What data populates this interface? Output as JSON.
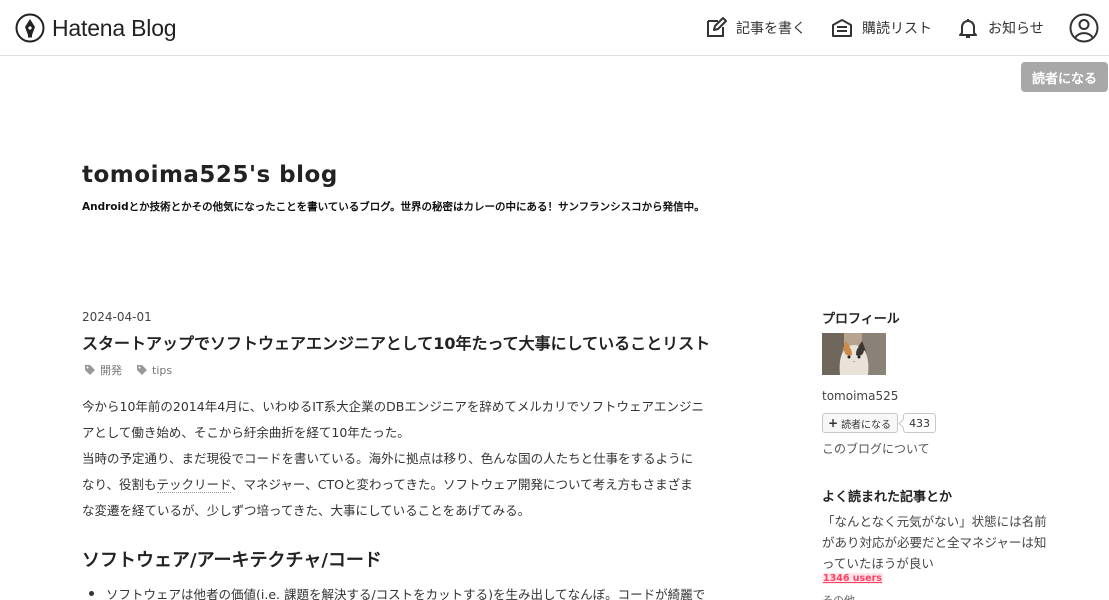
{
  "header": {
    "brand": "Hatena Blog",
    "nav": {
      "write": "記事を書く",
      "subscriptions": "購読リスト",
      "notifications": "お知らせ"
    },
    "subscribe_button": "読者になる"
  },
  "blog": {
    "title": "tomoima525's blog",
    "description": "Androidとか技術とかその他気になったことを書いているブログ。世界の秘密はカレーの中にある！サンフランシスコから発信中。"
  },
  "entry": {
    "date": "2024-04-01",
    "title": "スタートアップでソフトウェアエンジニアとして10年たって大事にしていることリスト",
    "categories": [
      "開発",
      "tips"
    ],
    "body": {
      "line1": "今から10年前の2014年4月に、いわゆるIT系大企業のDBエンジニアを辞めてメルカリでソフトウェアエンジニ",
      "line2": "アとして働き始め、そこから紆余曲折を経て10年たった。",
      "line3": "当時の予定通り、まだ現役でコードを書いている。海外に拠点は移り、色んな国の人たちと仕事をするように",
      "line4_pre": "なり、役割も",
      "line4_link": "テックリード",
      "line4_post": "、マネジャー、CTOと変わってきた。ソフトウェア開発について考え方もさまざま",
      "line5": "な変遷を経ているが、少しずつ培ってきた、大事にしていることをあげてみる。"
    },
    "section_heading": "ソフトウェア/アーキテクチャ/コード",
    "list_first": "ソフトウェアは他者の価値(i.e. 課題を解決する/コストをカットする)を生み出してなんぼ。コードが綺麗で"
  },
  "sidebar": {
    "profile": {
      "heading": "プロフィール",
      "name": "tomoima525",
      "reader_button": "読者になる",
      "reader_count": "433",
      "about": "このブログについて"
    },
    "popular": {
      "heading": "よく読まれた記事とか",
      "item_title": "「なんとなく元気がない」状態には名前があり対応が必要だと全マネジャーは知っていたほうが良い",
      "item_users": "1346 users",
      "next_partial": "その他..."
    }
  },
  "colors": {
    "accent_badge": "#ff4166",
    "subscribe_bg": "#a8a8a8"
  }
}
